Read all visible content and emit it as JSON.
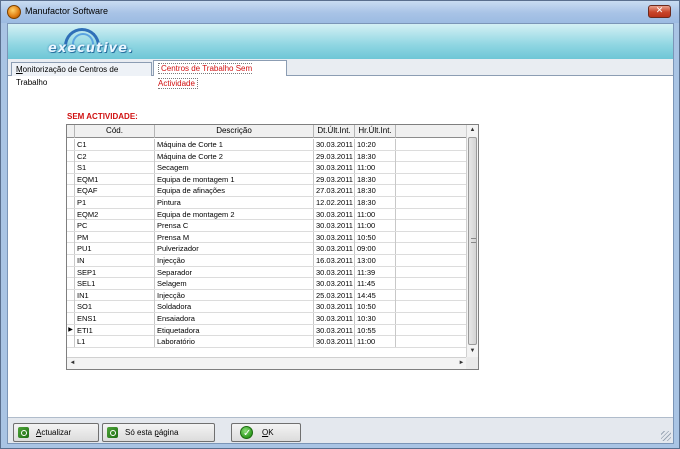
{
  "window": {
    "title": "Manufactor Software",
    "close_glyph": "✕"
  },
  "banner": {
    "logo_text": "executive."
  },
  "tabs": [
    {
      "prefix": "M",
      "rest": "onitorização de Centros de Trabalho"
    },
    {
      "label": "Centros de Trabalho Sem Actividade"
    }
  ],
  "section_label": "SEM ACTIVIDADE:",
  "grid": {
    "headers": {
      "cod": "Cód.",
      "desc": "Descrição",
      "dt": "Dt.Últ.Int.",
      "hr": "Hr.Últ.Int."
    },
    "current_row_marker": "▶",
    "rows": [
      {
        "cod": "C1",
        "desc": "Máquina de Corte 1",
        "dt": "30.03.2011",
        "hr": "10:20"
      },
      {
        "cod": "C2",
        "desc": "Máquina de Corte 2",
        "dt": "29.03.2011",
        "hr": "18:30"
      },
      {
        "cod": "S1",
        "desc": "Secagem",
        "dt": "30.03.2011",
        "hr": "11:00"
      },
      {
        "cod": "EQM1",
        "desc": "Equipa de montagem 1",
        "dt": "29.03.2011",
        "hr": "18:30"
      },
      {
        "cod": "EQAF",
        "desc": "Equipa de afinações",
        "dt": "27.03.2011",
        "hr": "18:30"
      },
      {
        "cod": "P1",
        "desc": "Pintura",
        "dt": "12.02.2011",
        "hr": "18:30"
      },
      {
        "cod": "EQM2",
        "desc": "Equipa de montagem 2",
        "dt": "30.03.2011",
        "hr": "11:00"
      },
      {
        "cod": "PC",
        "desc": "Prensa C",
        "dt": "30.03.2011",
        "hr": "11:00"
      },
      {
        "cod": "PM",
        "desc": "Prensa M",
        "dt": "30.03.2011",
        "hr": "10:50"
      },
      {
        "cod": "PU1",
        "desc": "Pulverizador",
        "dt": "30.03.2011",
        "hr": "09:00"
      },
      {
        "cod": "IN",
        "desc": "Injecção",
        "dt": "16.03.2011",
        "hr": "13:00"
      },
      {
        "cod": "SEP1",
        "desc": "Separador",
        "dt": "30.03.2011",
        "hr": "11:39"
      },
      {
        "cod": "SEL1",
        "desc": "Selagem",
        "dt": "30.03.2011",
        "hr": "11:45"
      },
      {
        "cod": "IN1",
        "desc": "Injecção",
        "dt": "25.03.2011",
        "hr": "14:45"
      },
      {
        "cod": "SO1",
        "desc": "Soldadora",
        "dt": "30.03.2011",
        "hr": "10:50"
      },
      {
        "cod": "ENS1",
        "desc": "Ensaiadora",
        "dt": "30.03.2011",
        "hr": "10:30"
      },
      {
        "cod": "ETI1",
        "desc": "Etiquetadora",
        "dt": "30.03.2011",
        "hr": "10:55"
      },
      {
        "cod": "L1",
        "desc": "Laboratório",
        "dt": "30.03.2011",
        "hr": "11:00"
      }
    ],
    "current_row_index": 16
  },
  "scroll_glyphs": {
    "up": "▲",
    "down": "▼",
    "left": "◄",
    "right": "►"
  },
  "buttons": {
    "actualizar": {
      "prefix": "A",
      "rest": "ctualizar"
    },
    "so_esta_pagina": {
      "before": "Só esta ",
      "ul": "p",
      "after": "ágina"
    },
    "ok": {
      "ul": "O",
      "rest": "K"
    }
  },
  "icons": {
    "app": "app-icon",
    "refresh": "refresh-icon",
    "page": "page-refresh-icon",
    "ok": "check-icon"
  },
  "colors": {
    "accent_red": "#d01010",
    "banner": "#8fd6e2",
    "title_bar": "#a8c3e6"
  }
}
